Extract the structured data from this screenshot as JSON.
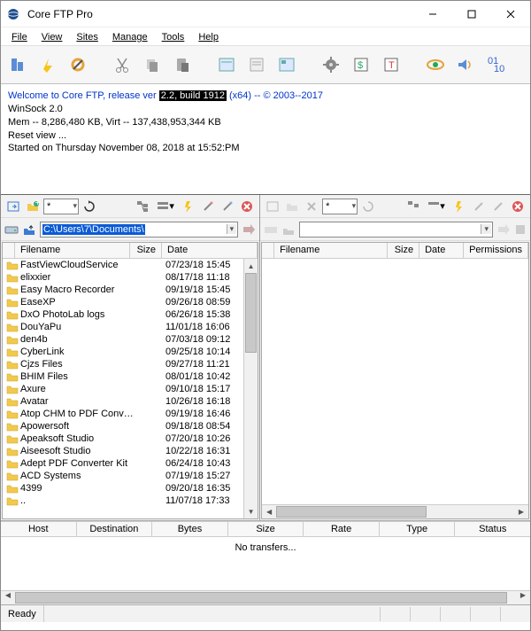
{
  "title": "Core FTP Pro",
  "menus": [
    "File",
    "View",
    "Sites",
    "Manage",
    "Tools",
    "Help"
  ],
  "log": {
    "l1_pre": "Welcome to Core FTP, release ver",
    "l1_hl": "2.2, build 1912",
    "l1_post": " (x64) -- © 2003--2017",
    "l2": "WinSock 2.0",
    "l3": "Mem -- 8,286,480 KB, Virt -- 137,438,953,344 KB",
    "l4": "Reset view ...",
    "l5": "Started on Thursday November 08, 2018 at 15:52:PM"
  },
  "left": {
    "path": "C:\\Users\\7\\Documents\\",
    "cols": {
      "handle": "",
      "name": "Filename",
      "size": "Size",
      "date": "Date"
    },
    "rows": [
      {
        "name": "..",
        "size": "",
        "date": "11/07/18  17:33"
      },
      {
        "name": "4399",
        "size": "",
        "date": "09/20/18  16:35"
      },
      {
        "name": "ACD Systems",
        "size": "",
        "date": "07/19/18  15:27"
      },
      {
        "name": "Adept PDF Converter Kit",
        "size": "",
        "date": "06/24/18  10:43"
      },
      {
        "name": "Aiseesoft Studio",
        "size": "",
        "date": "10/22/18  16:31"
      },
      {
        "name": "Apeaksoft Studio",
        "size": "",
        "date": "07/20/18  10:26"
      },
      {
        "name": "Apowersoft",
        "size": "",
        "date": "09/18/18  08:54"
      },
      {
        "name": "Atop CHM to PDF Convert...",
        "size": "",
        "date": "09/19/18  16:46"
      },
      {
        "name": "Avatar",
        "size": "",
        "date": "10/26/18  16:18"
      },
      {
        "name": "Axure",
        "size": "",
        "date": "09/10/18  15:17"
      },
      {
        "name": "BHIM Files",
        "size": "",
        "date": "08/01/18  10:42"
      },
      {
        "name": "Cjzs Files",
        "size": "",
        "date": "09/27/18  11:21"
      },
      {
        "name": "CyberLink",
        "size": "",
        "date": "09/25/18  10:14"
      },
      {
        "name": "den4b",
        "size": "",
        "date": "07/03/18  09:12"
      },
      {
        "name": "DouYaPu",
        "size": "",
        "date": "11/01/18  16:06"
      },
      {
        "name": "DxO PhotoLab logs",
        "size": "",
        "date": "06/26/18  15:38"
      },
      {
        "name": "EaseXP",
        "size": "",
        "date": "09/26/18  08:59"
      },
      {
        "name": "Easy Macro Recorder",
        "size": "",
        "date": "09/19/18  15:45"
      },
      {
        "name": "elixxier",
        "size": "",
        "date": "08/17/18  11:18"
      },
      {
        "name": "FastViewCloudService",
        "size": "",
        "date": "07/23/18  15:45"
      }
    ]
  },
  "right": {
    "cols": {
      "handle": "",
      "name": "Filename",
      "size": "Size",
      "date": "Date",
      "perm": "Permissions"
    }
  },
  "queue": {
    "cols": [
      "Host",
      "Destination",
      "Bytes",
      "Size",
      "Rate",
      "Type",
      "Status"
    ],
    "empty": "No transfers..."
  },
  "status": "Ready"
}
